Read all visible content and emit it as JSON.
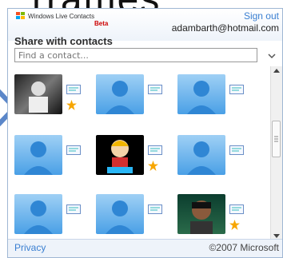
{
  "background": {
    "text": "rrames"
  },
  "header": {
    "logo_text": "Windows Live Contacts",
    "beta": "Beta",
    "sign_out": "Sign out",
    "email": "adambarth@hotmail.com"
  },
  "share": {
    "title": "Share with contacts",
    "search_placeholder": "Find a contact..."
  },
  "contacts": [
    {
      "avatar": "photo-person-dark",
      "has_star": true
    },
    {
      "avatar": "generic-person",
      "has_star": false
    },
    {
      "avatar": "generic-person",
      "has_star": false
    },
    {
      "avatar": "generic-person",
      "has_star": false
    },
    {
      "avatar": "cartoon-character",
      "has_star": true
    },
    {
      "avatar": "generic-person",
      "has_star": false
    },
    {
      "avatar": "generic-person",
      "has_star": false
    },
    {
      "avatar": "generic-person",
      "has_star": false
    },
    {
      "avatar": "photo-person-face",
      "has_star": true
    }
  ],
  "footer": {
    "privacy": "Privacy",
    "copyright": "©2007 Microsoft"
  },
  "colors": {
    "link": "#3a7fd1",
    "avatar_blue": "#4aa0e6",
    "star": "#f7a600"
  }
}
